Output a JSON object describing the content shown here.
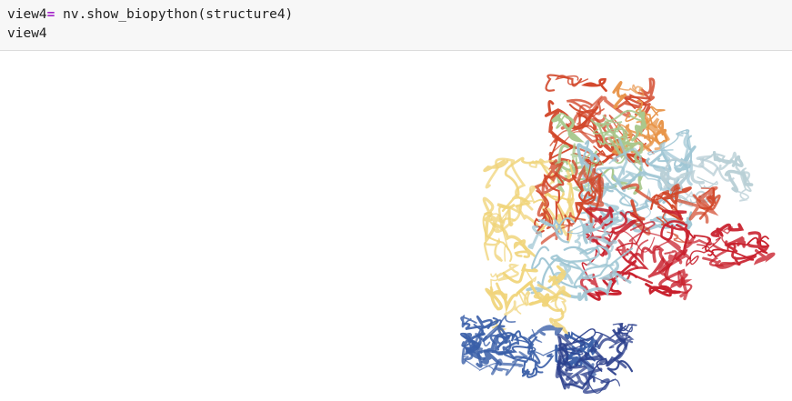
{
  "code_cell": {
    "line1": {
      "var": "view4",
      "op": "=",
      "rest": " nv.show_biopython(structure4)"
    },
    "line2": "view4"
  },
  "viewer": {
    "content": "3D protein structure cartoon rendering",
    "chain_colors": [
      "#d2472a",
      "#e8954a",
      "#a8c98e",
      "#9fc6d4",
      "#b9cfd6",
      "#f0d47a",
      "#c81f2c",
      "#3a5fa8",
      "#2b3f8c"
    ]
  }
}
